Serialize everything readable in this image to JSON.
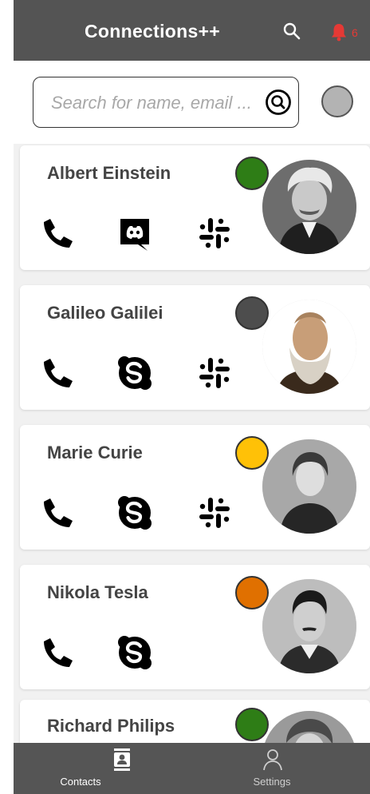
{
  "header": {
    "title": "Connections++",
    "notification_count": "6",
    "icons": [
      "search-icon",
      "bell-icon"
    ]
  },
  "search": {
    "placeholder": "Search for name, email ...",
    "icon": "search-circle-icon"
  },
  "self_status": {
    "color": "#b3b3b3"
  },
  "contacts": [
    {
      "name": "Albert Einstein",
      "status_color": "#2e7d16",
      "actions": [
        "phone-icon",
        "discord-icon",
        "slack-icon"
      ]
    },
    {
      "name": "Galileo Galilei",
      "status_color": "#4d4d4d",
      "actions": [
        "phone-icon",
        "skype-icon",
        "slack-icon"
      ]
    },
    {
      "name": "Marie Curie",
      "status_color": "#ffc107",
      "actions": [
        "phone-icon",
        "skype-icon",
        "slack-icon"
      ]
    },
    {
      "name": "Nikola Tesla",
      "status_color": "#e07000",
      "actions": [
        "phone-icon",
        "skype-icon"
      ]
    },
    {
      "name": "Richard Philips",
      "status_color": "#2e7d16",
      "actions": []
    }
  ],
  "nav": {
    "contacts_label": "Contacts",
    "settings_label": "Settings"
  },
  "colors": {
    "header_bg": "#545454",
    "nav_bg": "#555555",
    "notification": "#e53935"
  }
}
